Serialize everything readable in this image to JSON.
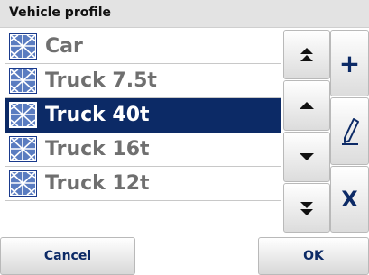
{
  "header": {
    "title": "Vehicle profile"
  },
  "list": {
    "selected_index": 2,
    "items": [
      {
        "label": "Car",
        "icon": "vehicle-profile-icon"
      },
      {
        "label": "Truck 7.5t",
        "icon": "vehicle-profile-icon"
      },
      {
        "label": "Truck 40t",
        "icon": "vehicle-profile-icon"
      },
      {
        "label": "Truck 16t",
        "icon": "vehicle-profile-icon"
      },
      {
        "label": "Truck 12t",
        "icon": "vehicle-profile-icon"
      }
    ]
  },
  "scroll_buttons": {
    "page_up_icon": "double-chevron-up-icon",
    "up_icon": "chevron-up-icon",
    "down_icon": "chevron-down-icon",
    "page_down_icon": "double-chevron-down-icon"
  },
  "actions": {
    "add_glyph": "+",
    "edit_icon": "pencil-icon",
    "delete_glyph": "X"
  },
  "footer": {
    "cancel_label": "Cancel",
    "ok_label": "OK"
  },
  "colors": {
    "selection": "#0c2a66",
    "accent": "#0c2a66",
    "item_text": "#6f6f6f"
  }
}
